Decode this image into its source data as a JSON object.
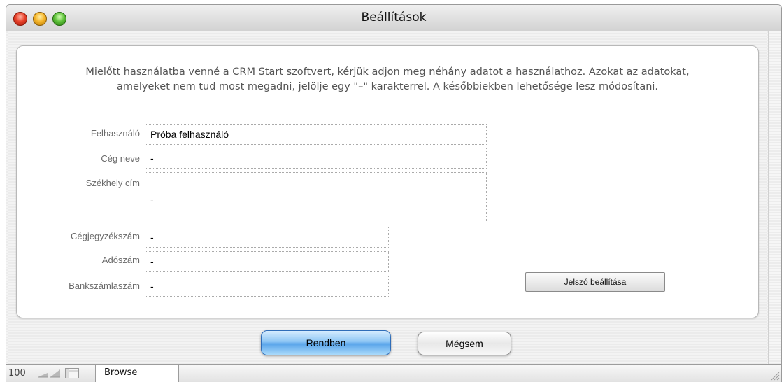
{
  "window": {
    "title": "Beállítások"
  },
  "intro": {
    "line1": "Mielőtt használatba venné a CRM Start szoftvert, kérjük adjon meg néhány adatot a használathoz. Azokat az adatokat,",
    "line2": "amelyeket nem tud most megadni, jelölje egy \"–\" karakterrel. A későbbiekben lehetősége lesz módosítani."
  },
  "fields": {
    "user": {
      "label": "Felhasználó",
      "value": "Próba felhasználó"
    },
    "company": {
      "label": "Cég neve",
      "value": "-"
    },
    "address": {
      "label": "Székhely cím",
      "value": "-"
    },
    "regnum": {
      "label": "Cégjegyzékszám",
      "value": "-"
    },
    "taxnum": {
      "label": "Adószám",
      "value": "-"
    },
    "bank": {
      "label": "Bankszámlaszám",
      "value": "-"
    }
  },
  "buttons": {
    "password": "Jelszó beállítása",
    "ok": "Rendben",
    "cancel": "Mégsem"
  },
  "statusbar": {
    "zoom": "100",
    "mode": "Browse"
  },
  "icons": {
    "close": "close-icon",
    "minimize": "minimize-icon",
    "zoom": "zoom-icon",
    "zoom_out": "zoom-out-icon",
    "zoom_in": "zoom-in-icon",
    "status_toggle": "status-toggle-icon",
    "resize": "resize-grip-icon"
  },
  "colors": {
    "default_button": "#5aa5ea",
    "close": "#e8412a",
    "minimize": "#f5b52a",
    "zoom": "#5ec23a"
  }
}
